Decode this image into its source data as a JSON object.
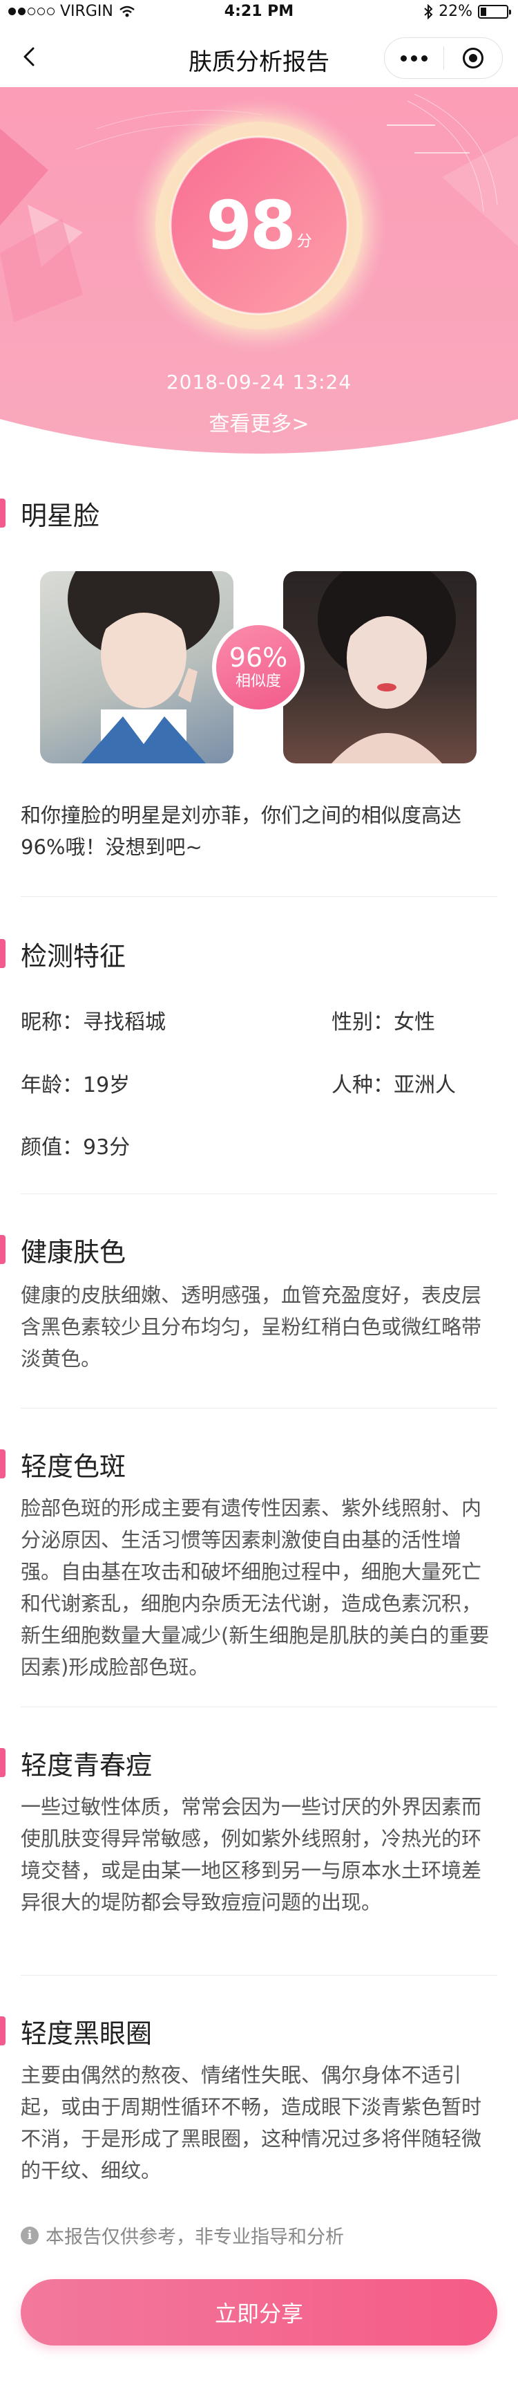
{
  "status_bar": {
    "carrier": "VIRGIN",
    "time": "4:21 PM",
    "battery": "22%",
    "battery_level": 0.22
  },
  "nav": {
    "title": "肤质分析报告"
  },
  "hero": {
    "score": "98",
    "score_unit": "分",
    "date": "2018-09-24 13:24",
    "more_link": "查看更多>"
  },
  "star": {
    "title": "明星脸",
    "similarity_pct": "96%",
    "similarity_label": "相似度",
    "description": "和你撞脸的明星是刘亦菲，你们之间的相似度高达96%哦！没想到吧~"
  },
  "features": {
    "title": "检测特征",
    "nickname": "昵称：寻找稻城",
    "gender": "性别：女性",
    "age": "年龄：19岁",
    "race": "人种：亚洲人",
    "beauty": "颜值：93分"
  },
  "sections": [
    {
      "title": "健康肤色",
      "body": "健康的皮肤细嫩、透明感强，血管充盈度好，表皮层含黑色素较少且分布均匀，呈粉红稍白色或微红略带淡黄色。"
    },
    {
      "title": "轻度色斑",
      "body": "脸部色斑的形成主要有遗传性因素、紫外线照射、内分泌原因、生活习惯等因素刺激使自由基的活性增强。自由基在攻击和破坏细胞过程中，细胞大量死亡和代谢紊乱，细胞内杂质无法代谢，造成色素沉积，新生细胞数量大量减少(新生细胞是肌肤的美白的重要因素)形成脸部色斑。"
    },
    {
      "title": "轻度青春痘",
      "body": "一些过敏性体质，常常会因为一些讨厌的外界因素而使肌肤变得异常敏感，例如紫外线照射，冷热光的环境交替，或是由某一地区移到另一与原本水土环境差异很大的堤防都会导致痘痘问题的出现。"
    },
    {
      "title": "轻度黑眼圈",
      "body": "主要由偶然的熬夜、情绪性失眠、偶尔身体不适引起，或由于周期性循环不畅，造成眼下淡青紫色暂时不消，于是形成了黑眼圈，这种情况过多将伴随轻微的干纹、细纹。"
    }
  ],
  "disclaimer": "本报告仅供参考，非专业指导和分析",
  "share_button": "立即分享",
  "colors": {
    "accent": "#f25b8b",
    "hero_pink": "#f9a4bb",
    "button_start": "#f2799c",
    "button_end": "#f55b86"
  }
}
